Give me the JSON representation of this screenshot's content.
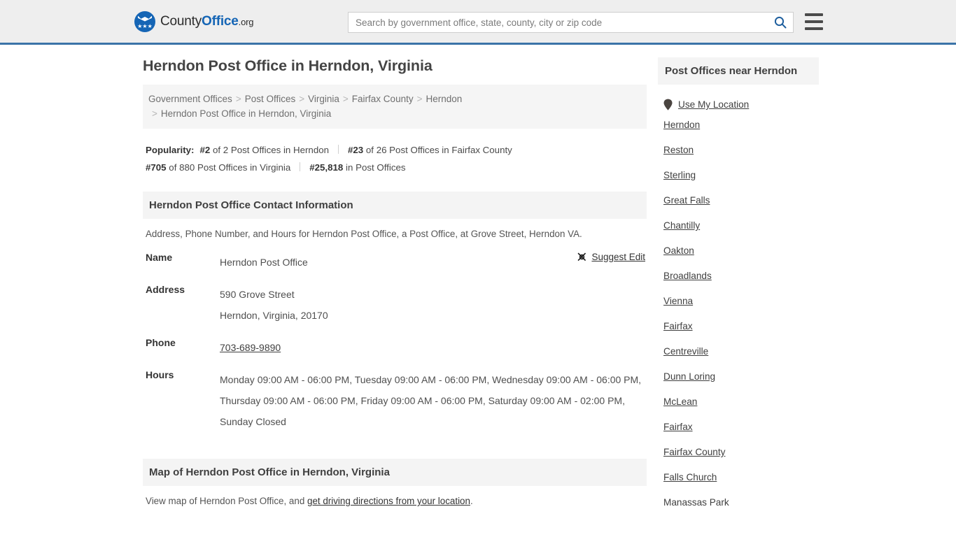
{
  "header": {
    "logo": {
      "part1": "County",
      "part2": "Office",
      "part3": ".org",
      "icon": "eagle-seal-icon",
      "stars": "★★★"
    },
    "search": {
      "placeholder": "Search by government office, state, county, city or zip code",
      "value": "",
      "icon": "search-icon"
    },
    "menu_icon": "hamburger-menu-icon",
    "accent_color": "#3b74a8"
  },
  "main": {
    "title": "Herndon Post Office in Herndon, Virginia",
    "breadcrumb": {
      "items": [
        "Government Offices",
        "Post Offices",
        "Virginia",
        "Fairfax County",
        "Herndon"
      ],
      "current": "Herndon Post Office in Herndon, Virginia",
      "separator": ">"
    },
    "popularity": {
      "label": "Popularity:",
      "entries": [
        {
          "rank": "#2",
          "text": "of 2 Post Offices in Herndon"
        },
        {
          "rank": "#23",
          "text": "of 26 Post Offices in Fairfax County"
        },
        {
          "rank": "#705",
          "text": "of 880 Post Offices in Virginia"
        },
        {
          "rank": "#25,818",
          "text": "in Post Offices"
        }
      ]
    },
    "contact": {
      "heading": "Herndon Post Office Contact Information",
      "description": "Address, Phone Number, and Hours for Herndon Post Office, a Post Office, at Grove Street, Herndon VA.",
      "suggest_edit": {
        "label": "Suggest Edit",
        "icon": "edit-suggest-icon"
      },
      "rows": {
        "name_key": "Name",
        "name_value": "Herndon Post Office",
        "address_key": "Address",
        "address_line1": "590 Grove Street",
        "address_line2": "Herndon, Virginia, 20170",
        "phone_key": "Phone",
        "phone_value": "703-689-9890",
        "hours_key": "Hours",
        "hours_value": "Monday 09:00 AM - 06:00 PM, Tuesday 09:00 AM - 06:00 PM, Wednesday 09:00 AM - 06:00 PM, Thursday 09:00 AM - 06:00 PM, Friday 09:00 AM - 06:00 PM, Saturday 09:00 AM - 02:00 PM, Sunday Closed"
      }
    },
    "map": {
      "heading": "Map of Herndon Post Office in Herndon, Virginia",
      "desc_before": "View map of Herndon Post Office, and ",
      "link": "get driving directions from your location",
      "desc_after": "."
    }
  },
  "sidebar": {
    "heading": "Post Offices near Herndon",
    "use_my_location": {
      "label": "Use My Location",
      "icon": "map-pin-icon"
    },
    "places": [
      "Herndon",
      "Reston",
      "Sterling",
      "Great Falls",
      "Chantilly",
      "Oakton",
      "Broadlands",
      "Vienna",
      "Fairfax",
      "Centreville",
      "Dunn Loring",
      "McLean",
      "Fairfax",
      "Fairfax County",
      "Falls Church",
      "Manassas Park"
    ]
  }
}
